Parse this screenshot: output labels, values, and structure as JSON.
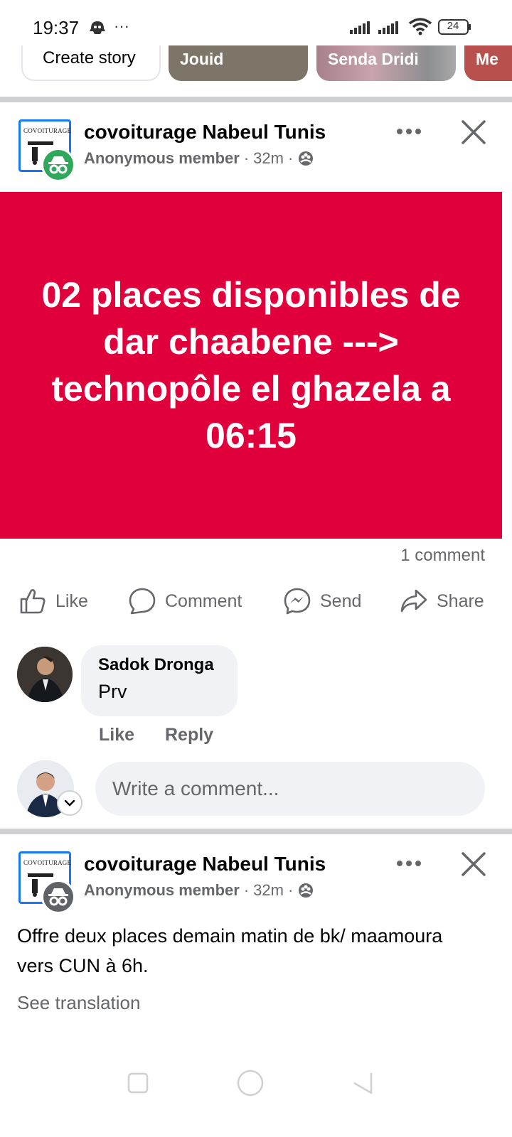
{
  "status_bar": {
    "time": "19:37",
    "battery": "24"
  },
  "stories": [
    {
      "label": "Create story"
    },
    {
      "label": "Jouid"
    },
    {
      "label": "Senda Dridi"
    },
    {
      "label": "Me"
    }
  ],
  "post1": {
    "group_name": "covoiturage Nabeul Tunis",
    "group_logo_text": "COVOITURAGE",
    "author": "Anonymous member",
    "sep1": "·",
    "time": "32m",
    "sep2": "·",
    "banner_text": "02 places disponibles de dar chaabene ---> technopôle el ghazela a 06:15",
    "banner_color": "#e0003c",
    "comment_count": "1 comment",
    "actions": {
      "like": "Like",
      "comment": "Comment",
      "send": "Send",
      "share": "Share"
    },
    "comment": {
      "author": "Sadok Dronga",
      "text": "Prv",
      "like": "Like",
      "reply": "Reply"
    },
    "write_placeholder": "Write a comment..."
  },
  "post2": {
    "group_name": "covoiturage Nabeul Tunis",
    "group_logo_text": "COVOITURAGE",
    "author": "Anonymous member",
    "sep1": "·",
    "time": "32m",
    "sep2": "·",
    "text": "Offre deux places demain matin de bk/ maamoura vers CUN à 6h.",
    "see_translation": "See translation"
  },
  "colors": {
    "accent": "#1877f2",
    "secondary_text": "#65676b",
    "anon_badge_green": "#2fa85c",
    "anon_badge_gray": "#5f6368"
  },
  "icons": [
    "snapchat-ghost-icon",
    "more-horizontal-icon",
    "signal-icon",
    "wifi-icon",
    "battery-icon",
    "group-audience-icon",
    "close-icon",
    "like-icon",
    "comment-icon",
    "messenger-icon",
    "share-icon",
    "chevron-down-icon",
    "incognito-icon"
  ]
}
